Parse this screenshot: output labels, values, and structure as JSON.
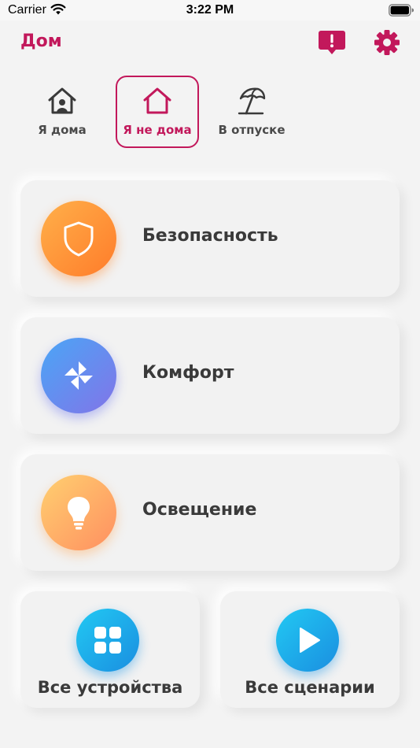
{
  "status_bar": {
    "carrier": "Carrier",
    "time": "3:22 PM"
  },
  "header": {
    "title": "Дом"
  },
  "modes": [
    {
      "label": "Я дома",
      "icon": "home-person-icon",
      "active": false
    },
    {
      "label": "Я не дома",
      "icon": "home-icon",
      "active": true
    },
    {
      "label": "В отпуске",
      "icon": "beach-umbrella-icon",
      "active": false
    }
  ],
  "categories": [
    {
      "label": "Безопасность",
      "icon": "shield-icon"
    },
    {
      "label": "Комфорт",
      "icon": "fan-icon"
    },
    {
      "label": "Освещение",
      "icon": "lightbulb-icon"
    }
  ],
  "shortcuts": [
    {
      "label": "Все устройства",
      "icon": "grid-icon"
    },
    {
      "label": "Все сценарии",
      "icon": "play-icon"
    }
  ],
  "colors": {
    "accent": "#c2185b",
    "security": "#ff8a33",
    "comfort": "#6b8af0",
    "lighting": "#ffb46a",
    "shortcut": "#1faee9"
  }
}
